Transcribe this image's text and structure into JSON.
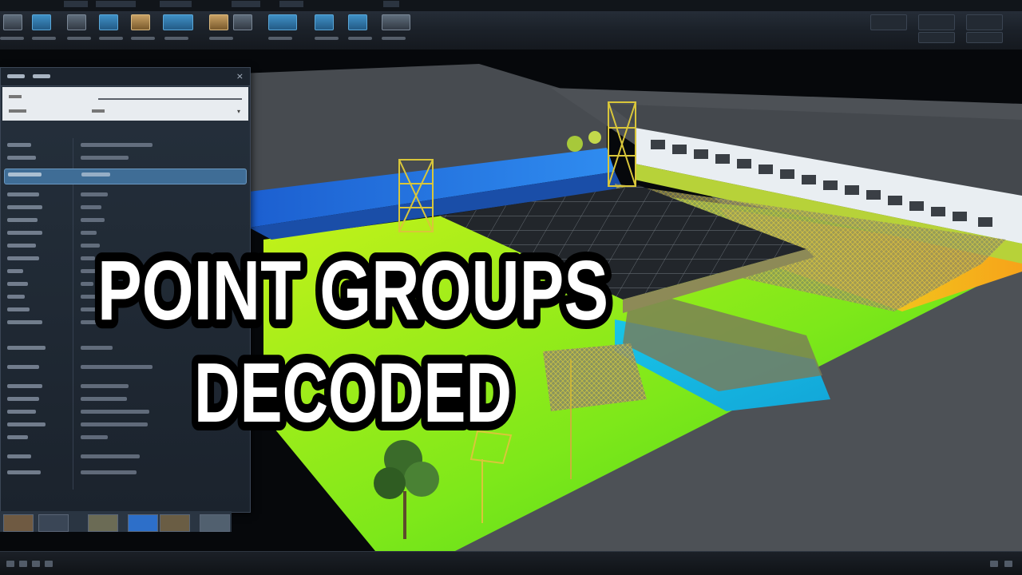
{
  "headline": {
    "line1": "POINT GROUPS",
    "line2": "DECODED"
  },
  "colors": {
    "ribbon_accent": "#3f90c6",
    "panel_bg": "#1f2832",
    "headline_fill": "#ffffff",
    "headline_outline": "#000000"
  },
  "icons": {
    "panel_close": "close-icon",
    "toolbar": [
      "home-icon",
      "layers-icon",
      "point-cloud-icon",
      "surface-icon",
      "view-icon",
      "settings-icon"
    ]
  }
}
